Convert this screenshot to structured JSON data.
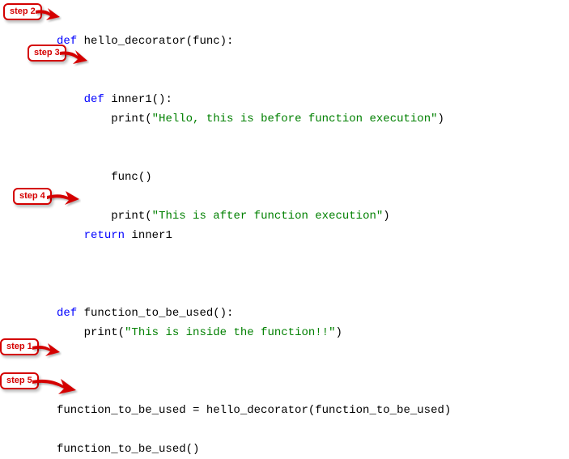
{
  "steps": {
    "s1": "step 1",
    "s2": "step 2",
    "s3": "step 3",
    "s4": "step 4",
    "s5": "step 5"
  },
  "code": {
    "l1_def": "def",
    "l1_name": " hello_decorator(func):",
    "l3_def": "def",
    "l3_name": " inner1():",
    "l4_print": "print",
    "l4_open": "(",
    "l4_str": "\"Hello, this is before function execution\"",
    "l4_close": ")",
    "l7_func": "func()",
    "l9_print": "print",
    "l9_open": "(",
    "l9_str": "\"This is after function execution\"",
    "l9_close": ")",
    "l10_ret": "return",
    "l10_name": " inner1",
    "l13_def": "def",
    "l13_name": " function_to_be_used():",
    "l14_print": "print",
    "l14_open": "(",
    "l14_str": "\"This is inside the function!!\"",
    "l14_close": ")",
    "l17_line": "function_to_be_used = hello_decorator(function_to_be_used)",
    "l18_line": "function_to_be_used()"
  }
}
